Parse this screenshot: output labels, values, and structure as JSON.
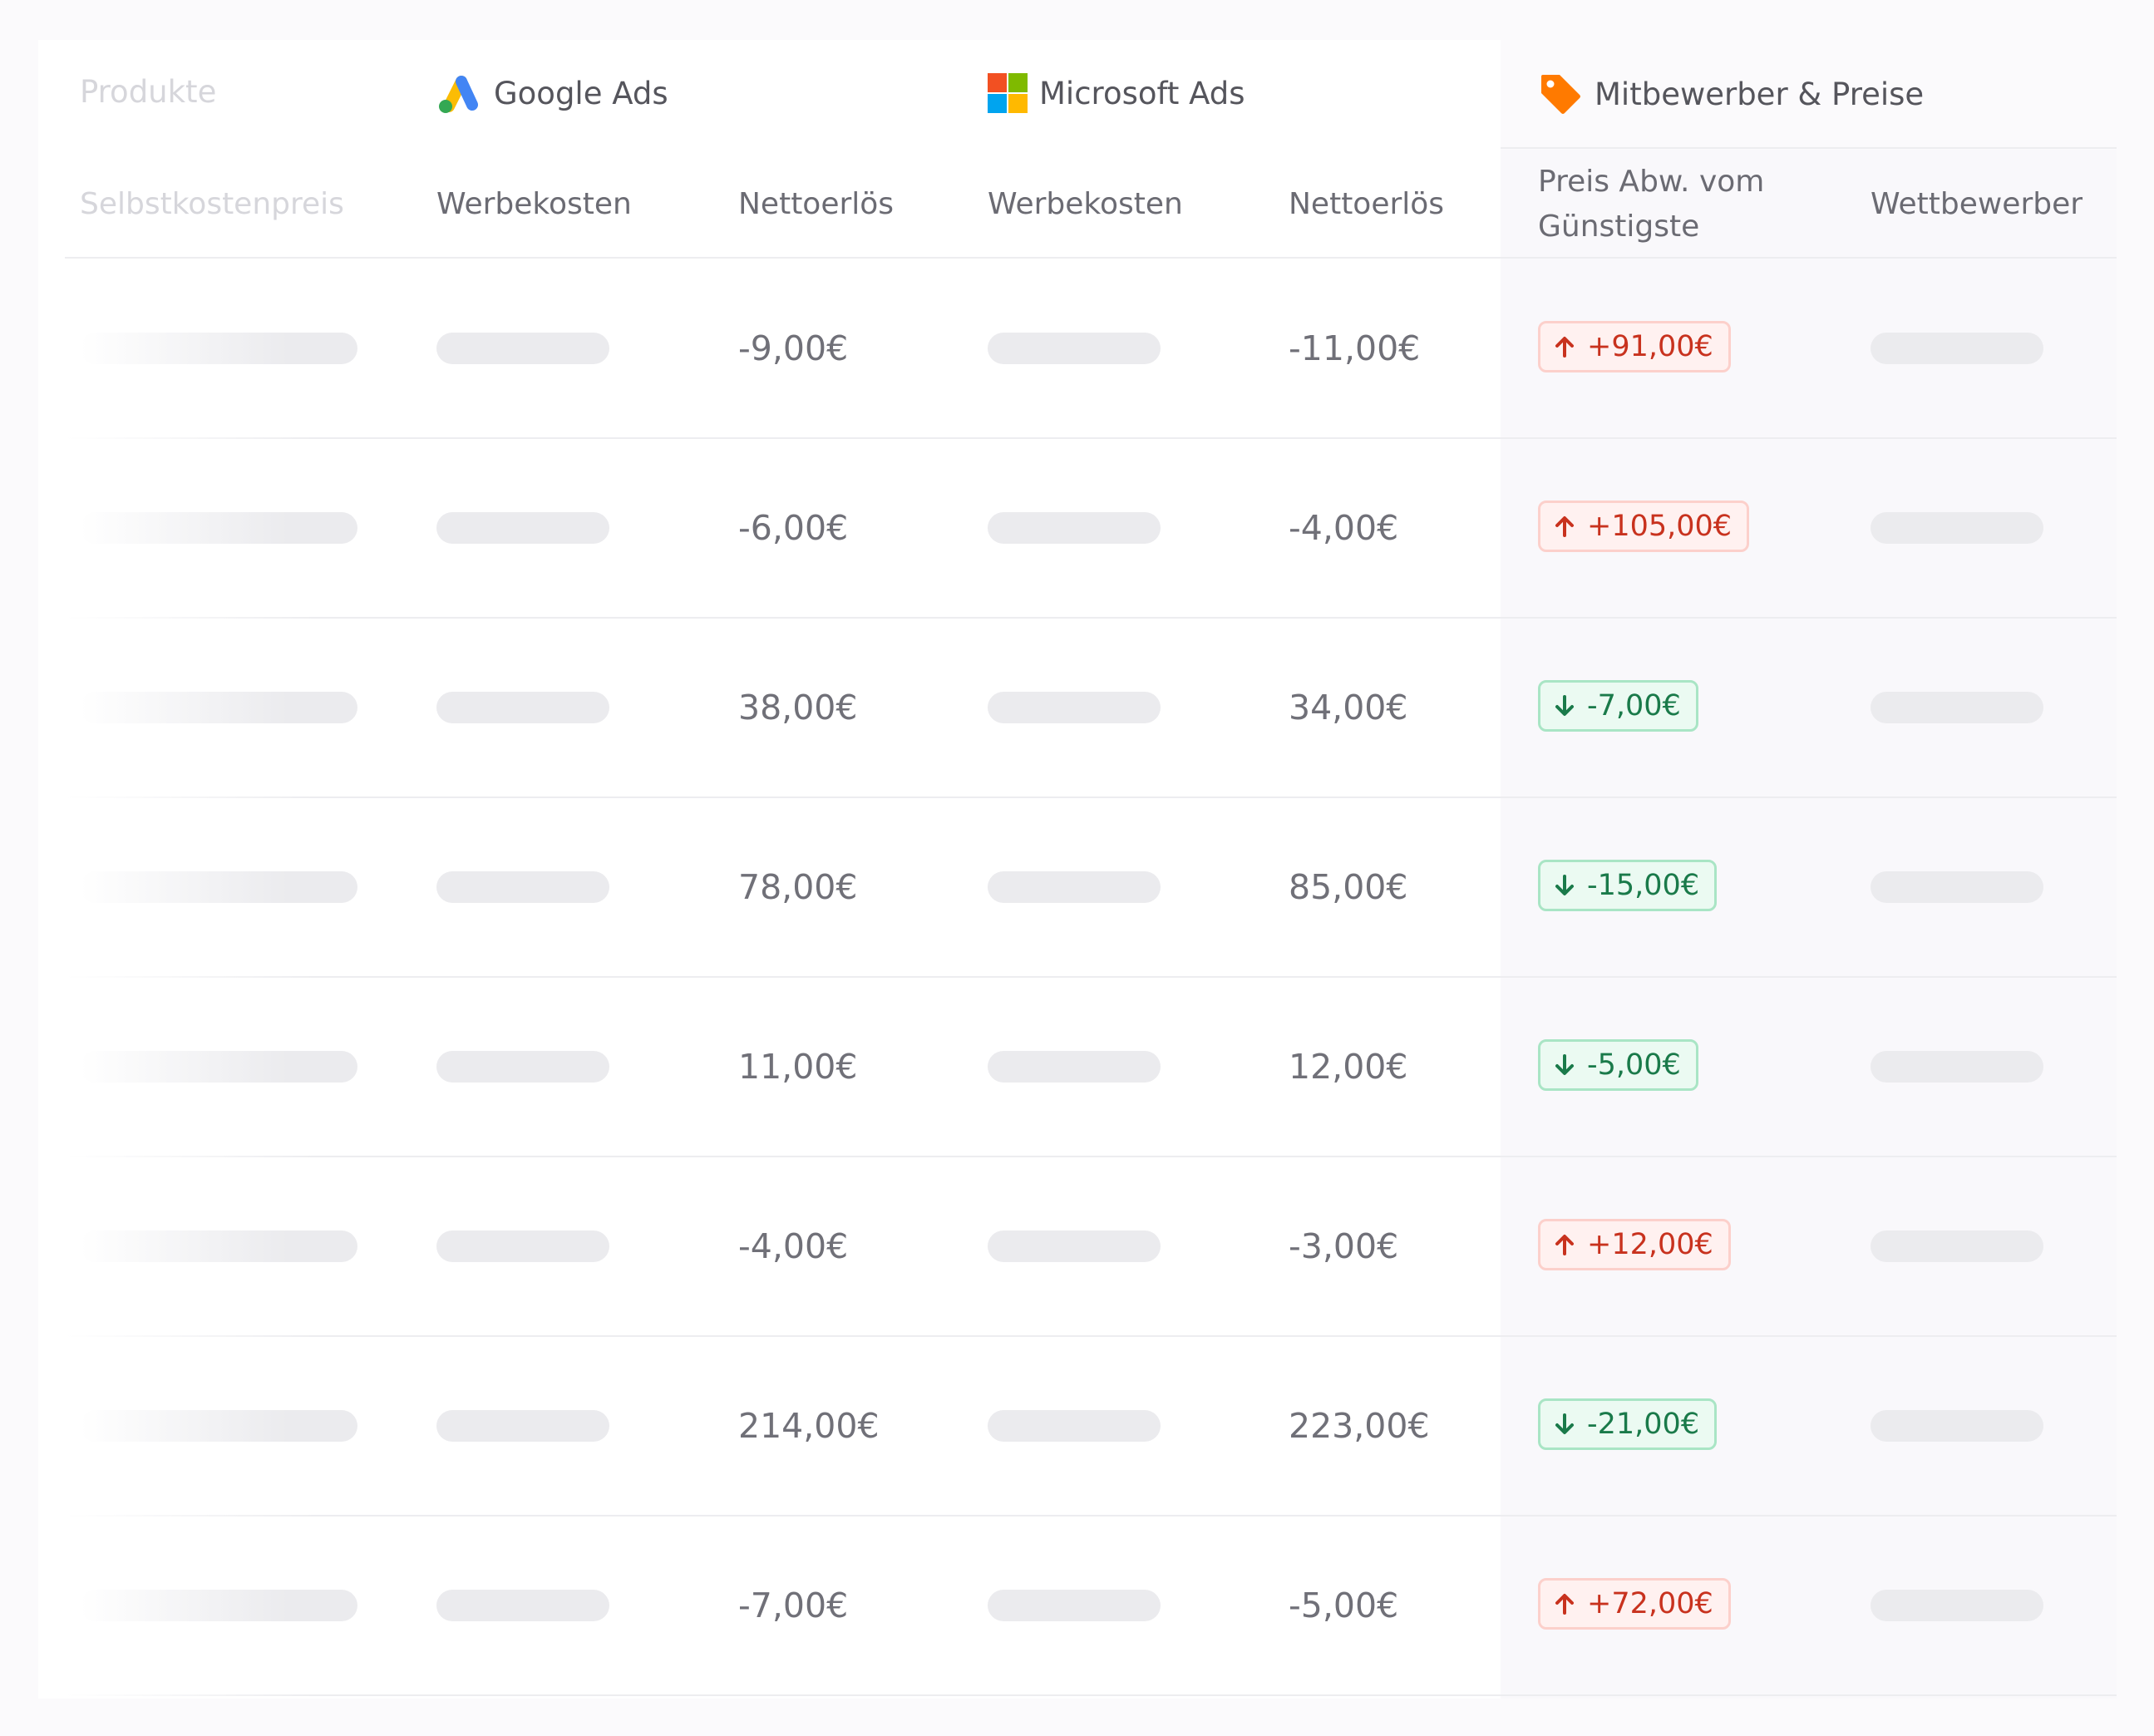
{
  "colors": {
    "badge_up_text": "#c8321e",
    "badge_down_text": "#1a7a4a",
    "google_blue": "#4285f4",
    "google_yellow": "#fbbc04",
    "google_green": "#34a853",
    "ms_red": "#f25022",
    "ms_green": "#7fba00",
    "ms_blue": "#00a4ef",
    "ms_yellow": "#ffb900",
    "tag_orange": "#ff7a00"
  },
  "groups": {
    "products": "Produkte",
    "google": "Google Ads",
    "microsoft": "Microsoft Ads",
    "competitors": "Mitbewerber & Preise"
  },
  "columns": {
    "cost_price": "Selbstkostenpreis",
    "google_ad_cost": "Werbekosten",
    "google_net_revenue": "Nettoerlös",
    "ms_ad_cost": "Werbekosten",
    "ms_net_revenue": "Nettoerlös",
    "price_deviation_line1": "Preis Abw. vom",
    "price_deviation_line2": "Günstigste",
    "competitor": "Wettbewerber"
  },
  "icons": {
    "google": "google-ads-icon",
    "microsoft": "microsoft-icon",
    "competitors": "price-tag-icon",
    "up": "arrow-up-icon",
    "down": "arrow-down-icon"
  },
  "rows": [
    {
      "google_net": "-9,00€",
      "ms_net": "-11,00€",
      "deviation": "+91,00€",
      "direction": "up"
    },
    {
      "google_net": "-6,00€",
      "ms_net": "-4,00€",
      "deviation": "+105,00€",
      "direction": "up"
    },
    {
      "google_net": "38,00€",
      "ms_net": "34,00€",
      "deviation": "-7,00€",
      "direction": "down"
    },
    {
      "google_net": "78,00€",
      "ms_net": "85,00€",
      "deviation": "-15,00€",
      "direction": "down"
    },
    {
      "google_net": "11,00€",
      "ms_net": "12,00€",
      "deviation": "-5,00€",
      "direction": "down"
    },
    {
      "google_net": "-4,00€",
      "ms_net": "-3,00€",
      "deviation": "+12,00€",
      "direction": "up"
    },
    {
      "google_net": "214,00€",
      "ms_net": "223,00€",
      "deviation": "-21,00€",
      "direction": "down"
    },
    {
      "google_net": "-7,00€",
      "ms_net": "-5,00€",
      "deviation": "+72,00€",
      "direction": "up"
    }
  ]
}
